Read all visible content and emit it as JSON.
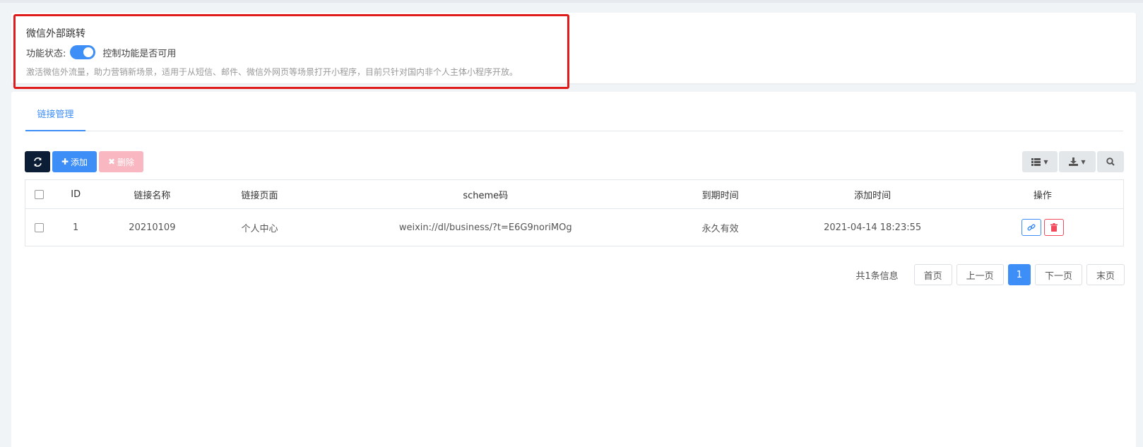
{
  "feature": {
    "title": "微信外部跳转",
    "status_label": "功能状态:",
    "toggle_on": true,
    "toggle_desc": "控制功能是否可用",
    "description": "激活微信外流量，助力营销新场景，适用于从短信、邮件、微信外网页等场景打开小程序，目前只针对国内非个人主体小程序开放。"
  },
  "tabs": [
    {
      "label": "链接管理",
      "active": true
    }
  ],
  "toolbar": {
    "add_label": "添加",
    "delete_label": "删除",
    "icons": [
      "refresh-icon",
      "plus-icon",
      "times-icon",
      "list-icon",
      "download-icon",
      "search-icon"
    ]
  },
  "table": {
    "headers": [
      "ID",
      "链接名称",
      "链接页面",
      "scheme码",
      "到期时间",
      "添加时间",
      "操作"
    ],
    "rows": [
      {
        "id": "1",
        "name": "20210109",
        "page": "个人中心",
        "scheme": "weixin://dl/business/?t=E6G9noriMOg",
        "expire": "永久有效",
        "added": "2021-04-14 18:23:55"
      }
    ]
  },
  "pagination": {
    "total_text": "共1条信息",
    "first": "首页",
    "prev": "上一页",
    "current": "1",
    "next": "下一页",
    "last": "末页"
  },
  "colors": {
    "accent": "#3e8ef7",
    "highlight": "#e01b1b",
    "danger": "#f04a5c",
    "dark": "#0c1e35"
  }
}
